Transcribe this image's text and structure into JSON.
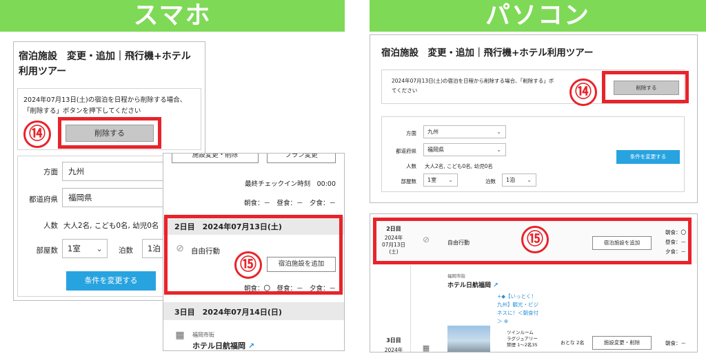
{
  "banners": {
    "sp": "スマホ",
    "pc": "パソコン"
  },
  "sp": {
    "title": "宿泊施設　変更・追加｜飛行機+ホテル利用ツアー",
    "notice_line1": "2024年07月13日(土)の宿泊を日程から削除する場合、",
    "notice_line2": "「削除する」ボタンを押下してください",
    "delete_label": "削除する",
    "marker14": "⑭",
    "area_label": "方面",
    "area_value": "九州",
    "pref_label": "都道府県",
    "pref_value": "福岡県",
    "people_label": "人数",
    "people_value": "大人2名, こども0名, 幼児0名",
    "rooms_label": "部屋数",
    "rooms_value": "1室",
    "nights_label": "泊数",
    "nights_value": "1泊",
    "change_label": "条件を変更する"
  },
  "sp2": {
    "top_btn1": "施設変更・削除",
    "top_btn2": "プラン変更",
    "checkin": "最終チェックイン時刻　00:00",
    "meals_top": "朝食：－　昼食：－　夕食：－",
    "day2": "2日目　2024年07月13日(土)",
    "free": "自由行動",
    "marker15": "⑮",
    "add_label": "宿泊施設を追加",
    "meals_day2": "朝食：〇　昼食：－　夕食：－",
    "day3": "3日目　2024年07月14日(日)",
    "city": "福岡市街",
    "hotel": "ホテル日航福岡"
  },
  "pc": {
    "title": "宿泊施設　変更・追加｜飛行機+ホテル利用ツアー",
    "notice_a": "2024年07月13日(土)の宿泊を日程から削除する場合、「削除する」ボ",
    "notice_b": "てください",
    "delete_label": "削除する",
    "marker14": "⑭",
    "area_label": "方面",
    "area_value": "九州",
    "pref_label": "都道府県",
    "pref_value": "福岡県",
    "people_label": "人数",
    "people_value": "大人2名, こども0名, 幼児0名",
    "rooms_label": "部屋数",
    "rooms_value": "1室",
    "nights_label": "泊数",
    "nights_value": "1泊",
    "change_label": "条件を変更する"
  },
  "pc2": {
    "day_label": "2日目",
    "date1": "2024年",
    "date2": "07月13日",
    "date3": "(土)",
    "free": "自由行動",
    "marker15": "⑮",
    "add_label": "宿泊施設を追加",
    "meal1": "朝食：〇",
    "meal2": "昼食：－",
    "meal3": "夕食：－",
    "city": "福岡市街",
    "hotel": "ホテル日航福岡",
    "promo1": "+◆【いっとく！",
    "promo2": "九州】観光・ビジ",
    "promo3": "ネスに！＜朝食付",
    "promo4": "＞ ⊕",
    "room1": "ツインルーム",
    "room2": "ラグジュアリー",
    "room3": "禁煙 1〜2名35",
    "day3": "3日目",
    "day3_year": "2024年",
    "adults": "おとな 2名",
    "change_label": "施設変更・削除",
    "meal_b": "朝食：－"
  },
  "colors": {
    "banner": "#7ed957",
    "red": "#e8232a",
    "blue": "#27a3e0"
  }
}
